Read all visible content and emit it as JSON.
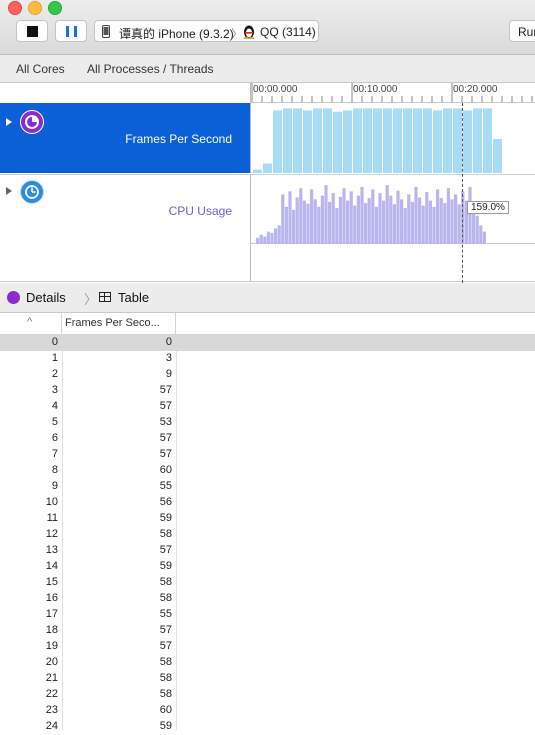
{
  "toolbar": {
    "target_device": "谭真的 iPhone (9.3.2)",
    "target_process": "QQ (3114)",
    "run_label": "Run"
  },
  "filter": {
    "cores": "All Cores",
    "processes": "All Processes / Threads"
  },
  "timeline": {
    "ticks": [
      "00:00.000",
      "00:10.000",
      "00:20.000"
    ],
    "fps_bars": [
      5,
      14,
      92,
      95,
      95,
      92,
      95,
      95,
      90,
      92,
      95,
      95,
      95,
      95,
      95,
      95,
      95,
      95,
      92,
      95,
      95,
      92,
      95,
      95,
      50
    ],
    "cpu_bars": [
      10,
      15,
      12,
      20,
      18,
      25,
      30,
      80,
      60,
      85,
      55,
      75,
      90,
      70,
      65,
      88,
      72,
      60,
      78,
      95,
      68,
      82,
      58,
      76,
      90,
      70,
      85,
      62,
      78,
      92,
      66,
      74,
      88,
      60,
      82,
      70,
      95,
      78,
      64,
      86,
      72,
      58,
      80,
      68,
      92,
      75,
      62,
      84,
      70,
      60,
      88,
      74,
      66,
      90,
      72,
      80,
      64,
      85,
      70,
      92,
      60,
      45,
      30,
      20
    ],
    "accent_fps": "#a6dcf5",
    "accent_cpu": "#b9b5ef",
    "cursor_value": "159.0%"
  },
  "tracks": {
    "fps_label": "Frames Per Second",
    "cpu_label": "CPU Usage"
  },
  "details": {
    "details_label": "Details",
    "table_label": "Table"
  },
  "table": {
    "col_index_sort": "^",
    "col_fps": "Frames Per Seco...",
    "rows": [
      {
        "idx": "0",
        "fps": "0"
      },
      {
        "idx": "1",
        "fps": "3"
      },
      {
        "idx": "2",
        "fps": "9"
      },
      {
        "idx": "3",
        "fps": "57"
      },
      {
        "idx": "4",
        "fps": "57"
      },
      {
        "idx": "5",
        "fps": "53"
      },
      {
        "idx": "6",
        "fps": "57"
      },
      {
        "idx": "7",
        "fps": "57"
      },
      {
        "idx": "8",
        "fps": "60"
      },
      {
        "idx": "9",
        "fps": "55"
      },
      {
        "idx": "10",
        "fps": "56"
      },
      {
        "idx": "11",
        "fps": "59"
      },
      {
        "idx": "12",
        "fps": "58"
      },
      {
        "idx": "13",
        "fps": "57"
      },
      {
        "idx": "14",
        "fps": "59"
      },
      {
        "idx": "15",
        "fps": "58"
      },
      {
        "idx": "16",
        "fps": "58"
      },
      {
        "idx": "17",
        "fps": "55"
      },
      {
        "idx": "18",
        "fps": "57"
      },
      {
        "idx": "19",
        "fps": "57"
      },
      {
        "idx": "20",
        "fps": "58"
      },
      {
        "idx": "21",
        "fps": "58"
      },
      {
        "idx": "22",
        "fps": "58"
      },
      {
        "idx": "23",
        "fps": "60"
      },
      {
        "idx": "24",
        "fps": "59"
      }
    ]
  }
}
